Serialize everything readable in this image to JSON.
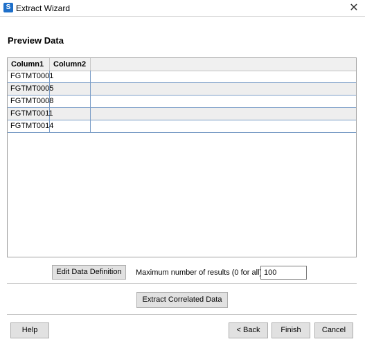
{
  "window": {
    "title": "Extract Wizard",
    "icon_glyph": "S",
    "close_glyph": "✕"
  },
  "page": {
    "heading": "Preview Data"
  },
  "grid": {
    "columns": [
      "Column1",
      "Column2"
    ],
    "rows": [
      [
        "FGTMT0001",
        ""
      ],
      [
        "FGTMT0005",
        ""
      ],
      [
        "FGTMT0008",
        ""
      ],
      [
        "FGTMT0011",
        ""
      ],
      [
        "FGTMT0014",
        ""
      ]
    ]
  },
  "controls": {
    "edit_data_definition_label": "Edit Data Definition",
    "max_results_label": "Maximum number of results (0 for all)",
    "max_results_value": "100",
    "extract_correlated_label": "Extract Correlated Data"
  },
  "footer": {
    "help_label": "Help",
    "back_label": "< Back",
    "finish_label": "Finish",
    "cancel_label": "Cancel"
  }
}
